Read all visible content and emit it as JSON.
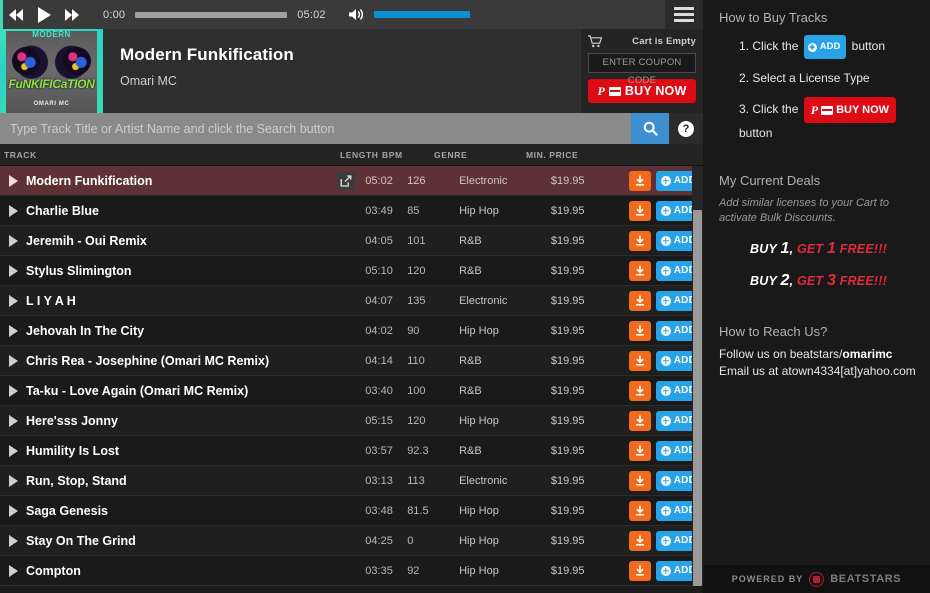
{
  "player": {
    "prev_icon": "rewind-icon",
    "play_icon": "play-icon",
    "next_icon": "fast-forward-icon",
    "current_time": "0:00",
    "duration": "05:02",
    "seek_progress_pct": 0,
    "volume_pct": 100,
    "volume_icon": "volume-icon",
    "menu_icon": "hamburger-menu-icon",
    "accent_color": "#3ddcb0"
  },
  "now_playing": {
    "title": "Modern Funkification",
    "artist": "Omari MC",
    "artwork": {
      "top_text": "MODERN",
      "mid_text": "FuNKIFICaTION",
      "bottom_text": "OMARI MC"
    }
  },
  "cart": {
    "icon": "shopping-cart-icon",
    "status": "Cart is Empty",
    "coupon_placeholder": "ENTER COUPON CODE",
    "coupon_value": "",
    "buy_now_label": "BUY NOW",
    "buy_now_color": "#dd0b14"
  },
  "search": {
    "placeholder": "Type Track Title or Artist Name and click the Search button",
    "value": "",
    "search_icon": "search-icon",
    "help_icon": "help-icon",
    "help_glyph": "?",
    "search_button_color": "#3d8fcf"
  },
  "table": {
    "columns": [
      "TRACK",
      "LENGTH",
      "BPM",
      "GENRE",
      "MIN. PRICE"
    ],
    "download_icon": "download-icon",
    "add_label": "ADD",
    "share_icon": "share-icon",
    "rows": [
      {
        "title": "Modern Funkification",
        "length": "05:02",
        "bpm": "126",
        "genre": "Electronic",
        "price": "$19.95",
        "active": true,
        "has_share": true
      },
      {
        "title": "Charlie Blue",
        "length": "03:49",
        "bpm": "85",
        "genre": "Hip Hop",
        "price": "$19.95",
        "active": false,
        "has_share": false
      },
      {
        "title": "Jeremih - Oui Remix",
        "length": "04:05",
        "bpm": "101",
        "genre": "R&B",
        "price": "$19.95",
        "active": false,
        "has_share": false
      },
      {
        "title": "Stylus Slimington",
        "length": "05:10",
        "bpm": "120",
        "genre": "R&B",
        "price": "$19.95",
        "active": false,
        "has_share": false
      },
      {
        "title": "L I Y A H",
        "length": "04:07",
        "bpm": "135",
        "genre": "Electronic",
        "price": "$19.95",
        "active": false,
        "has_share": false
      },
      {
        "title": "Jehovah In The City",
        "length": "04:02",
        "bpm": "90",
        "genre": "Hip Hop",
        "price": "$19.95",
        "active": false,
        "has_share": false
      },
      {
        "title": "Chris Rea - Josephine (Omari MC Remix)",
        "length": "04:14",
        "bpm": "110",
        "genre": "R&B",
        "price": "$19.95",
        "active": false,
        "has_share": false
      },
      {
        "title": "Ta-ku - Love Again (Omari MC Remix)",
        "length": "03:40",
        "bpm": "100",
        "genre": "R&B",
        "price": "$19.95",
        "active": false,
        "has_share": false
      },
      {
        "title": "Here'sss Jonny",
        "length": "05:15",
        "bpm": "120",
        "genre": "Hip Hop",
        "price": "$19.95",
        "active": false,
        "has_share": false
      },
      {
        "title": "Humility Is Lost",
        "length": "03:57",
        "bpm": "92.3",
        "genre": "R&B",
        "price": "$19.95",
        "active": false,
        "has_share": false
      },
      {
        "title": "Run, Stop, Stand",
        "length": "03:13",
        "bpm": "113",
        "genre": "Electronic",
        "price": "$19.95",
        "active": false,
        "has_share": false
      },
      {
        "title": "Saga Genesis",
        "length": "03:48",
        "bpm": "81.5",
        "genre": "Hip Hop",
        "price": "$19.95",
        "active": false,
        "has_share": false
      },
      {
        "title": "Stay On The Grind",
        "length": "04:25",
        "bpm": "0",
        "genre": "Hip Hop",
        "price": "$19.95",
        "active": false,
        "has_share": false
      },
      {
        "title": "Compton",
        "length": "03:35",
        "bpm": "92",
        "genre": "Hip Hop",
        "price": "$19.95",
        "active": false,
        "has_share": false
      }
    ]
  },
  "sidebar": {
    "how_to_buy_heading": "How to Buy Tracks",
    "steps": [
      {
        "num": "1.",
        "before": "Click the",
        "chip": "ADD",
        "chip_type": "add",
        "after": "button"
      },
      {
        "num": "2.",
        "before": "Select a License Type",
        "chip": "",
        "chip_type": "none",
        "after": ""
      },
      {
        "num": "3.",
        "before": "Click the",
        "chip": "BUY NOW",
        "chip_type": "buy",
        "after": "button"
      }
    ],
    "deals_heading": "My Current Deals",
    "deals_note": "Add similar licenses to your Cart to activate Bulk Discounts.",
    "deals": [
      {
        "buy_word": "BUY",
        "buy_num": "1",
        "get_word": "GET",
        "get_num": "1",
        "free_word": "FREE!!!"
      },
      {
        "buy_word": "BUY",
        "buy_num": "2",
        "get_word": "GET",
        "get_num": "3",
        "free_word": "FREE!!!"
      }
    ],
    "reach_heading": "How to Reach Us?",
    "contact_line1_prefix": "Follow us on beatstars/",
    "contact_line1_handle": "omarimc",
    "contact_line2": "Email us at atown4334[at]yahoo.com",
    "powered_by": "POWERED BY",
    "powered_brand": "BEATSTARS",
    "powered_logo_icon": "beatstars-logo-icon"
  }
}
